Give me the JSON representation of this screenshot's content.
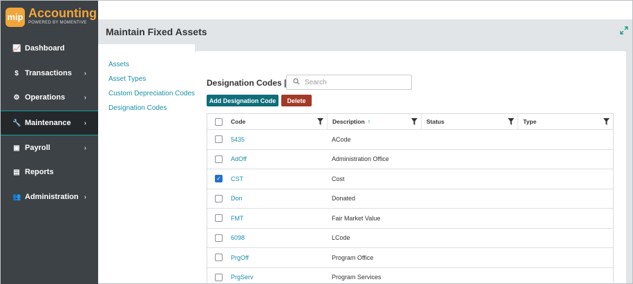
{
  "logo": {
    "badge": "mip",
    "title": "Accounting",
    "subtitle": "POWERED BY MOMENTIVE"
  },
  "nav": [
    {
      "label": "Dashboard",
      "icon": "chart-line-icon",
      "glyph": "📈",
      "chevron": false
    },
    {
      "label": "Transactions",
      "icon": "dollar-icon",
      "glyph": "$",
      "chevron": true
    },
    {
      "label": "Operations",
      "icon": "gears-icon",
      "glyph": "⚙",
      "chevron": true
    },
    {
      "label": "Maintenance",
      "icon": "wrench-icon",
      "glyph": "🔧",
      "chevron": true,
      "active": true
    },
    {
      "label": "Payroll",
      "icon": "money-icon",
      "glyph": "▣",
      "chevron": true
    },
    {
      "label": "Reports",
      "icon": "document-icon",
      "glyph": "▤",
      "chevron": false
    },
    {
      "label": "Administration",
      "icon": "users-icon",
      "glyph": "👥",
      "chevron": true
    }
  ],
  "header": {
    "title": "Maintain Fixed Assets"
  },
  "subnav": [
    {
      "label": "Assets"
    },
    {
      "label": "Asset Types"
    },
    {
      "label": "Custom Depreciation Codes"
    },
    {
      "label": "Designation Codes",
      "active": true
    }
  ],
  "section": {
    "title": "Designation Codes |"
  },
  "search": {
    "placeholder": "Search",
    "value": ""
  },
  "buttons": {
    "add": "Add Designation Code",
    "delete": "Delete"
  },
  "grid": {
    "columns": [
      "Code",
      "Description",
      "Status",
      "Type"
    ],
    "sort_indicator": "↑",
    "rows": [
      {
        "code": "5435",
        "description": "ACode",
        "status": "",
        "type": "",
        "checked": false
      },
      {
        "code": "AdOff",
        "description": "Administration Office",
        "status": "",
        "type": "",
        "checked": false
      },
      {
        "code": "CST",
        "description": "Cost",
        "status": "",
        "type": "",
        "checked": true
      },
      {
        "code": "Don",
        "description": "Donated",
        "status": "",
        "type": "",
        "checked": false
      },
      {
        "code": "FMT",
        "description": "Fair Market Value",
        "status": "",
        "type": "",
        "checked": false
      },
      {
        "code": "6098",
        "description": "LCode",
        "status": "",
        "type": "",
        "checked": false
      },
      {
        "code": "PrgOff",
        "description": "Program Office",
        "status": "",
        "type": "",
        "checked": false
      },
      {
        "code": "PrgServ",
        "description": "Program Services",
        "status": "",
        "type": "",
        "checked": false
      }
    ]
  },
  "colors": {
    "accent": "#1a8fa8",
    "sidebar": "#3d4246",
    "brand": "#f0a63a",
    "add_button": "#0f6e79",
    "delete_button": "#a33a26",
    "checkbox_checked": "#1f6fd1"
  }
}
